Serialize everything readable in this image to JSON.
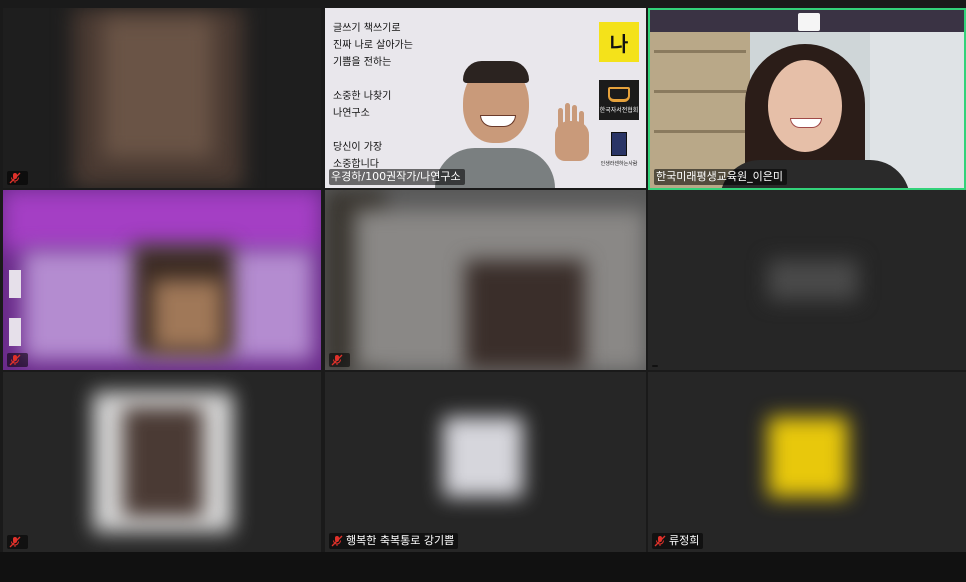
{
  "participants": {
    "tile1": {
      "name": ""
    },
    "tile2": {
      "name": "우경하/100권작가/나연구소",
      "slide_lines": [
        "글쓰기 책쓰기로",
        "진짜 나로 살아가는",
        "기쁨을 전하는",
        "",
        "소중한 나찾기",
        "나연구소",
        "",
        "당신이 가장",
        "소중합니다"
      ],
      "logo1": "나",
      "logo2_caption": "한국자서전협회",
      "logo3_caption": "인생라센하는사람"
    },
    "tile3": {
      "name": "한국미래평생교육원_이은미"
    },
    "tile4": {
      "name": ""
    },
    "tile5": {
      "name": ""
    },
    "tile6": {
      "name": ""
    },
    "tile7": {
      "name": ""
    },
    "tile8": {
      "name": "행복한 축복통로 강기쁨"
    },
    "tile9": {
      "name": "류정희"
    }
  },
  "colors": {
    "active_speaker": "#33d27a",
    "mic_muted": "#e0312a",
    "tile_bg": "#242424"
  },
  "icons": {
    "muted": "mic-muted-icon"
  }
}
